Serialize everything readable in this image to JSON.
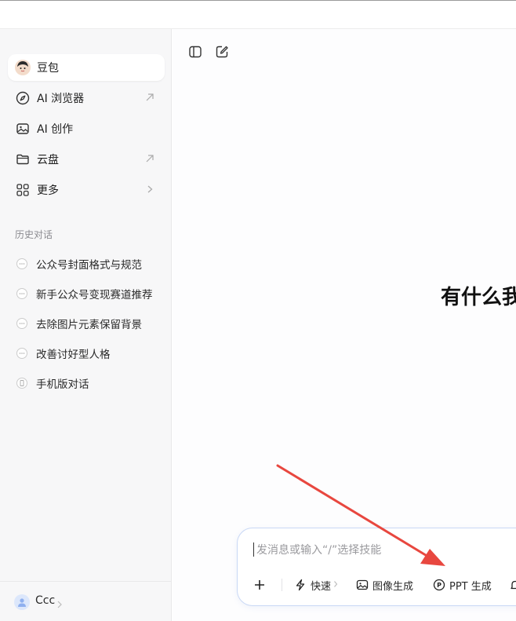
{
  "sidebar": {
    "nav": [
      {
        "label": "豆包",
        "icon": "avatar",
        "active": true
      },
      {
        "label": "AI 浏览器",
        "icon": "compass-icon",
        "external": true
      },
      {
        "label": "AI 创作",
        "icon": "image-icon"
      },
      {
        "label": "云盘",
        "icon": "folder-icon",
        "external": true
      },
      {
        "label": "更多",
        "icon": "grid-icon",
        "chevron": true
      }
    ],
    "history_title": "历史对话",
    "history": [
      {
        "label": "公众号封面格式与规范",
        "icon": "chat-bubble-icon"
      },
      {
        "label": "新手公众号变现赛道推荐",
        "icon": "chat-bubble-icon"
      },
      {
        "label": "去除图片元素保留背景",
        "icon": "chat-bubble-icon"
      },
      {
        "label": "改善讨好型人格",
        "icon": "chat-bubble-icon"
      },
      {
        "label": "手机版对话",
        "icon": "phone-icon"
      }
    ],
    "user": {
      "name": "Ccc"
    }
  },
  "main": {
    "hero_text": "有什么我",
    "composer": {
      "placeholder": "发消息或输入“/”选择技能",
      "chips": [
        {
          "label": "快速",
          "icon": "lightning-icon"
        },
        {
          "label": "图像生成",
          "icon": "image-icon"
        },
        {
          "label": "PPT 生成",
          "icon": "ppt-icon"
        }
      ]
    }
  },
  "colors": {
    "sidebar_bg": "#f7f7f8",
    "composer_border": "#c9d8f5",
    "annotation_arrow": "#e8473f"
  }
}
